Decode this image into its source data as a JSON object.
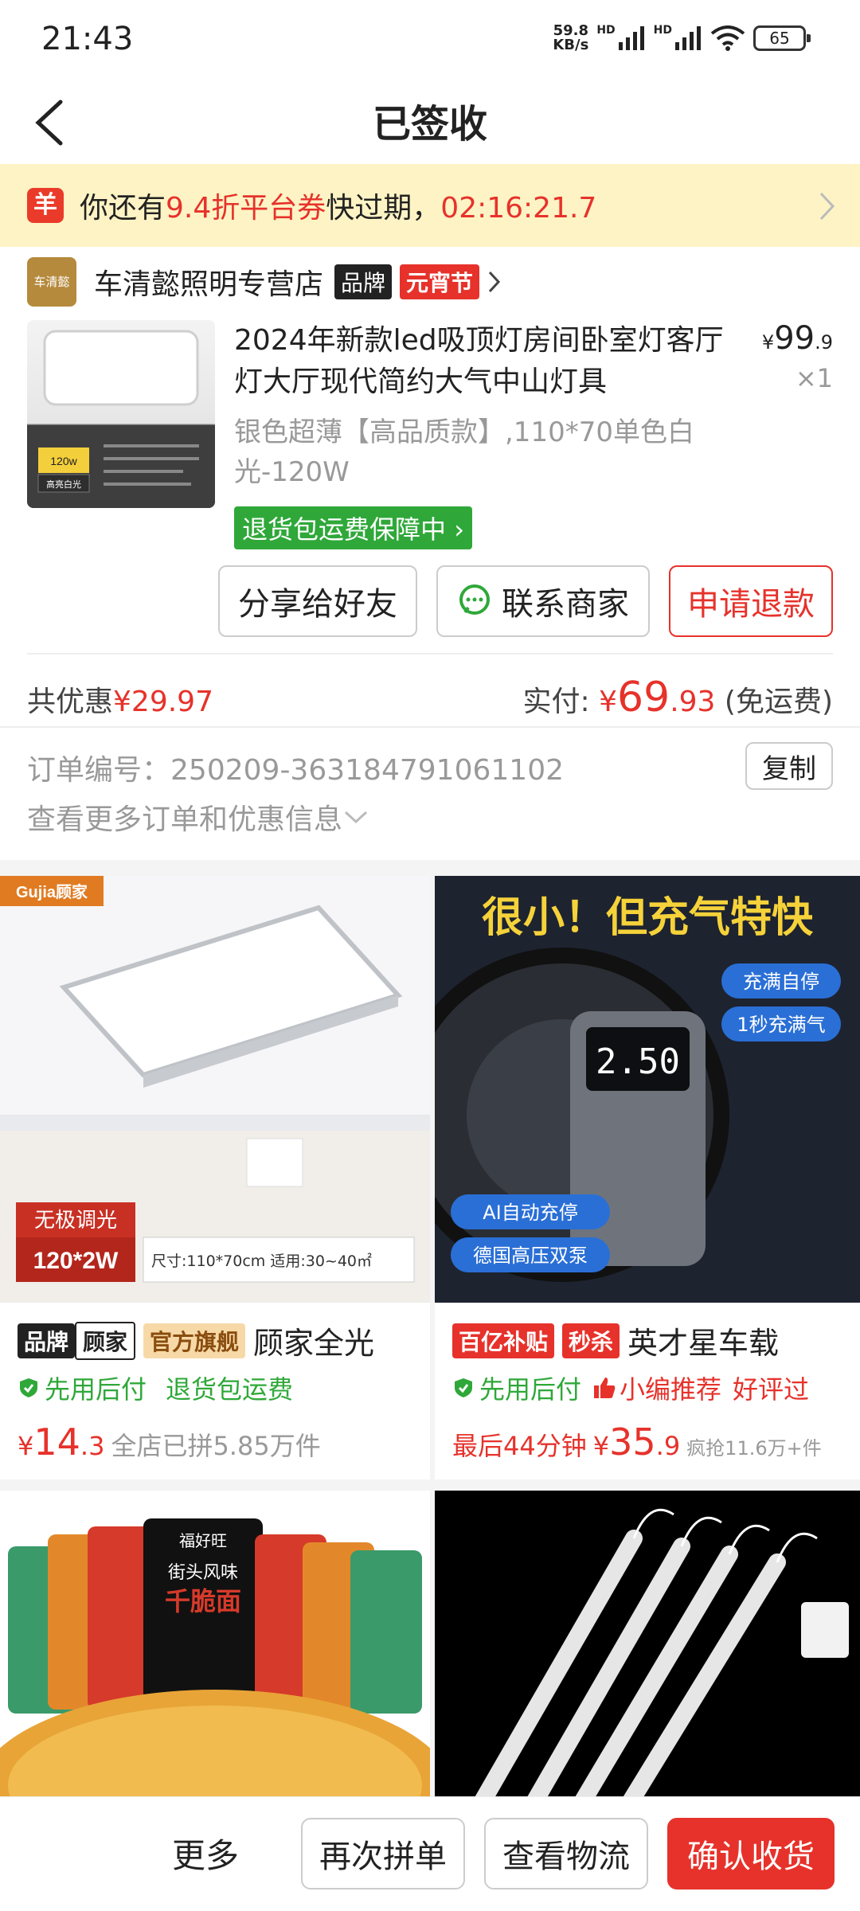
{
  "status": {
    "time": "21:43",
    "speed_value": "59.8",
    "speed_unit": "KB/s",
    "hd1": "HD",
    "hd2": "HD",
    "battery": "65"
  },
  "header": {
    "title": "已签收"
  },
  "coupon": {
    "icon": "羊",
    "prefix": "你还有",
    "discount": "9.4折平台券",
    "middle": "快过期，",
    "timer": "02:16:21.7"
  },
  "shop": {
    "logo_text": "车清懿",
    "name": "车清懿照明专营店",
    "brand_tag": "品牌",
    "fest_tag": "元宵节"
  },
  "product": {
    "title": "2024年新款led吸顶灯房间卧室灯客厅灯大厅现代简约大气中山灯具",
    "sku": "银色超薄【高品质款】,110*70单色白光-120W",
    "price_symbol": "¥",
    "price_int": "99",
    "price_dec": ".9",
    "qty": "×1",
    "return_tag": "退货包运费保障中",
    "image_badge_1": "120w",
    "image_badge_2": "高亮白光"
  },
  "actions": {
    "share": "分享给好友",
    "contact": "联系商家",
    "refund": "申请退款"
  },
  "summary": {
    "saving_label": "共优惠",
    "saving_value": "¥29.97",
    "paid_label": "实付:",
    "paid_symbol": "¥",
    "paid_int": "69",
    "paid_dec": ".93",
    "paid_note": "(免运费)"
  },
  "order": {
    "number_label": "订单编号：",
    "number": "250209-363184791061102",
    "copy": "复制",
    "more": "查看更多订单和优惠信息"
  },
  "recs": [
    {
      "brand_badge": "品牌",
      "brand_name": "顾家",
      "store_badge": "官方旗舰",
      "title": "顾家全光",
      "tag1": "先用后付",
      "tag2": "退货包运费",
      "price_symbol": "¥",
      "price_int": "14",
      "price_dec": ".3",
      "note": "全店已拼5.85万件",
      "img_logo": "Gujia顾家",
      "img_badge1": "无极调光",
      "img_badge2": "120*2W",
      "img_caption": "尺寸:110*70cm   适用:30~40㎡"
    },
    {
      "badge1": "百亿补贴",
      "badge2": "秒杀",
      "title": "英才星车载",
      "tag1": "先用后付",
      "tag2": "小编推荐",
      "tag3": "好评过",
      "countdown": "最后44分钟",
      "price_symbol": "¥",
      "price_int": "35",
      "price_dec": ".9",
      "note": "疯抢11.6万+件",
      "img_headline": "很小！但充气特快",
      "img_pill1": "充满自停",
      "img_pill2": "1秒充满气",
      "img_display": "2.50",
      "img_pill3": "AI自动充停",
      "img_pill4": "德国高压双泵"
    }
  ],
  "rec_more": [
    {
      "img_text1": "街头风味",
      "img_text2": "千脆面",
      "img_brand": "福好旺"
    },
    {
      "alt": "led灯条"
    }
  ],
  "bottom": {
    "more": "更多",
    "rebuy": "再次拼单",
    "logistics": "查看物流",
    "confirm": "确认收货"
  },
  "colors": {
    "accent": "#e6322b",
    "green": "#2fa839",
    "banner": "#fdf3c4"
  }
}
